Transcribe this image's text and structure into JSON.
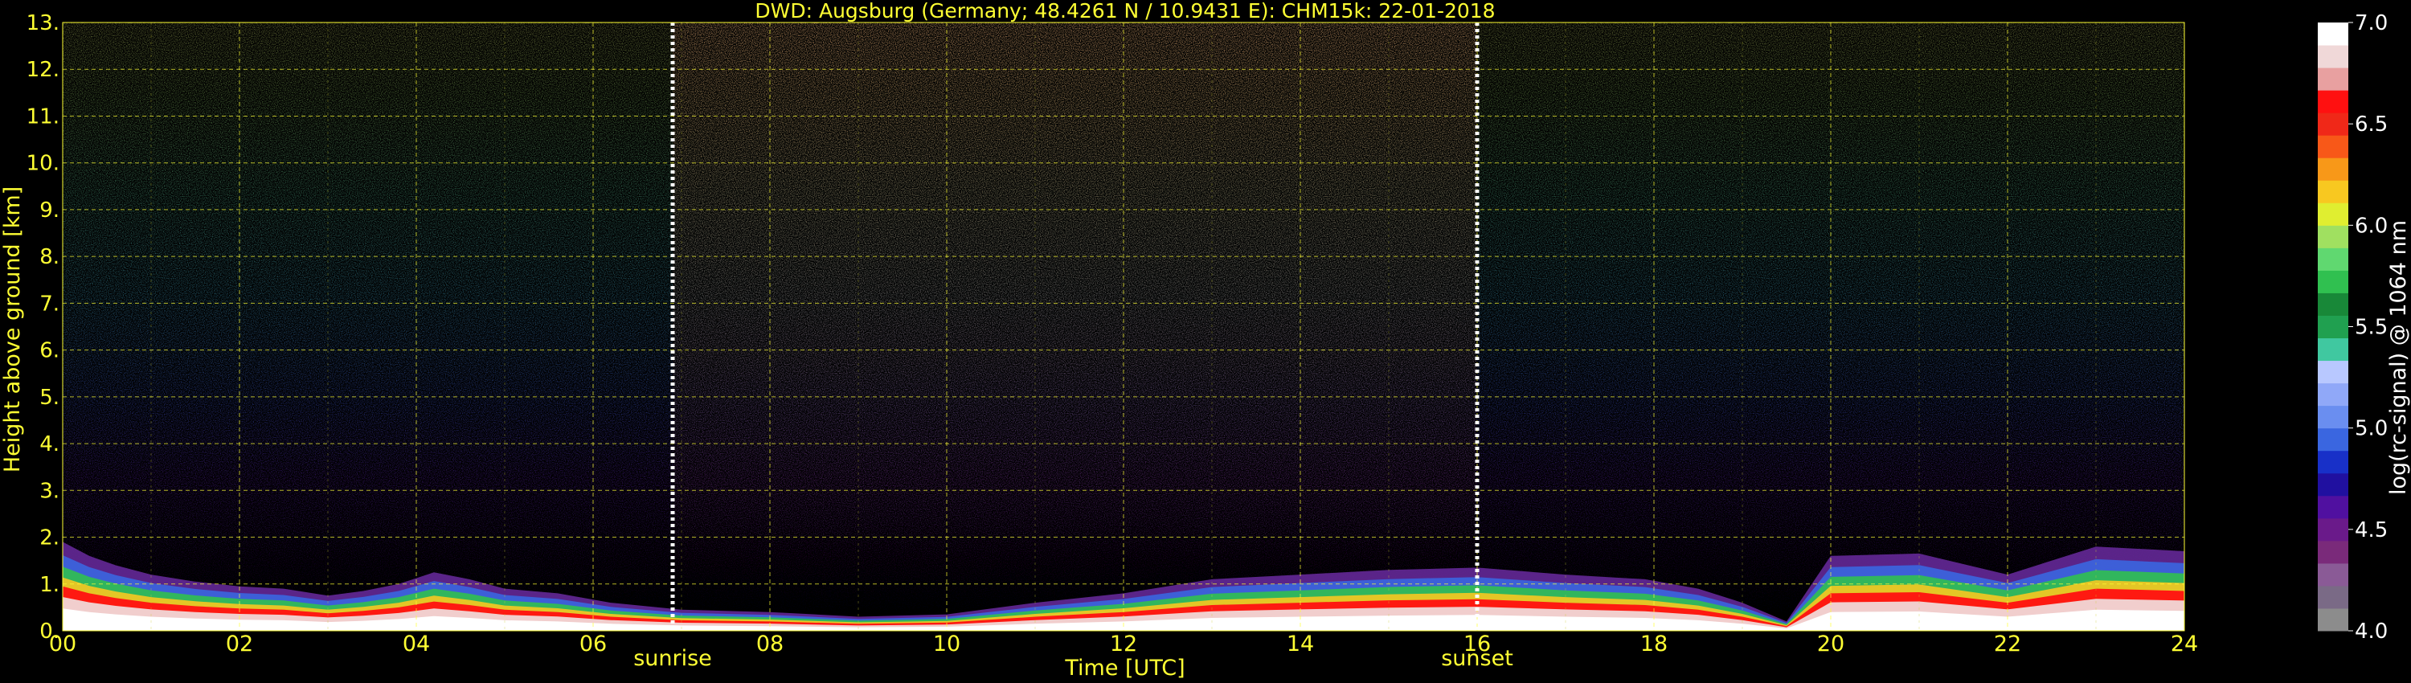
{
  "chart_data": {
    "type": "heatmap",
    "title": "DWD: Augsburg (Germany; 48.4261 N / 10.9431 E):    CHM15k: 22-01-2018",
    "xlabel": "Time [UTC]",
    "ylabel": "Height above ground [km]",
    "xlim": [
      0,
      24
    ],
    "ylim": [
      0,
      13
    ],
    "x_ticks": [
      "00",
      "02",
      "04",
      "06",
      "08",
      "10",
      "12",
      "14",
      "16",
      "18",
      "20",
      "22",
      "24"
    ],
    "y_ticks": [
      "0.",
      "1.",
      "2.",
      "3.",
      "4.",
      "5.",
      "6.",
      "7.",
      "8.",
      "9.",
      "10.",
      "11.",
      "12.",
      "13."
    ],
    "grid": true,
    "markers": [
      {
        "label": "sunrise",
        "x": 6.9
      },
      {
        "label": "sunset",
        "x": 16.0
      }
    ],
    "colorbar": {
      "label": "log(rc-signal) @ 1064 nm",
      "range": [
        4.0,
        7.0
      ],
      "ticks": [
        "4.0",
        "4.5",
        "5.0",
        "5.5",
        "6.0",
        "6.5",
        "7.0"
      ],
      "colors": [
        "#8c8c8c",
        "#7a6a86",
        "#8a5a96",
        "#7a2a7a",
        "#6a1a8a",
        "#5010a0",
        "#2010a0",
        "#1830c8",
        "#3a66e0",
        "#6a8ef0",
        "#90a8f8",
        "#b8c8ff",
        "#40c8a0",
        "#20a050",
        "#188838",
        "#30c050",
        "#60d870",
        "#a0e060",
        "#e0ee30",
        "#f8c820",
        "#f89818",
        "#f85818",
        "#f02818",
        "#ff1010",
        "#e8a0a0",
        "#f0d8d8",
        "#ffffff"
      ]
    },
    "low_layer": [
      {
        "t": 0.0,
        "h": 1.9
      },
      {
        "t": 0.3,
        "h": 1.6
      },
      {
        "t": 0.6,
        "h": 1.4
      },
      {
        "t": 1.0,
        "h": 1.2
      },
      {
        "t": 1.5,
        "h": 1.05
      },
      {
        "t": 2.0,
        "h": 0.95
      },
      {
        "t": 2.5,
        "h": 0.9
      },
      {
        "t": 3.0,
        "h": 0.75
      },
      {
        "t": 3.4,
        "h": 0.85
      },
      {
        "t": 3.8,
        "h": 1.0
      },
      {
        "t": 4.2,
        "h": 1.25
      },
      {
        "t": 4.6,
        "h": 1.1
      },
      {
        "t": 5.0,
        "h": 0.9
      },
      {
        "t": 5.6,
        "h": 0.8
      },
      {
        "t": 6.2,
        "h": 0.6
      },
      {
        "t": 7.0,
        "h": 0.45
      },
      {
        "t": 8.0,
        "h": 0.4
      },
      {
        "t": 9.0,
        "h": 0.3
      },
      {
        "t": 10.0,
        "h": 0.35
      },
      {
        "t": 11.0,
        "h": 0.6
      },
      {
        "t": 12.0,
        "h": 0.8
      },
      {
        "t": 13.0,
        "h": 1.1
      },
      {
        "t": 14.0,
        "h": 1.2
      },
      {
        "t": 15.0,
        "h": 1.3
      },
      {
        "t": 16.0,
        "h": 1.35
      },
      {
        "t": 17.0,
        "h": 1.2
      },
      {
        "t": 17.9,
        "h": 1.1
      },
      {
        "t": 18.5,
        "h": 0.9
      },
      {
        "t": 19.0,
        "h": 0.6
      },
      {
        "t": 19.5,
        "h": 0.2
      },
      {
        "t": 20.0,
        "h": 1.6
      },
      {
        "t": 21.0,
        "h": 1.65
      },
      {
        "t": 22.0,
        "h": 1.2
      },
      {
        "t": 23.0,
        "h": 1.8
      },
      {
        "t": 24.0,
        "h": 1.7
      }
    ]
  }
}
